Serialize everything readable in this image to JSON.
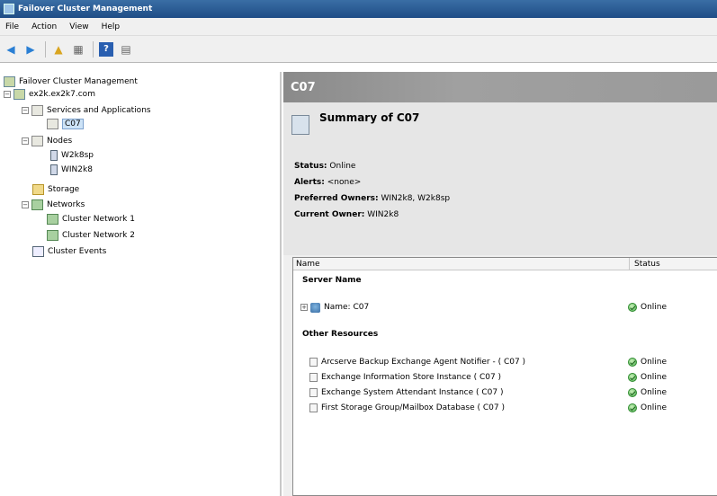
{
  "window": {
    "title": "Failover Cluster Management"
  },
  "menu": [
    "File",
    "Action",
    "View",
    "Help"
  ],
  "toolbar": {
    "buttons": [
      "back-icon",
      "forward-icon",
      "up-folder-icon",
      "show-hide-tree-icon",
      "help-icon",
      "properties-icon"
    ]
  },
  "tree": {
    "root": "Failover Cluster Management",
    "cluster": "ex2k.ex2k7.com",
    "services": "Services and Applications",
    "service_item": "C07",
    "nodes": "Nodes",
    "node_items": [
      "W2k8sp",
      "WIN2k8"
    ],
    "storage": "Storage",
    "networks": "Networks",
    "network_items": [
      "Cluster Network 1",
      "Cluster Network 2"
    ],
    "events": "Cluster Events"
  },
  "main": {
    "header": "C07",
    "summary_title": "Summary of C07",
    "status_label": "Status:",
    "status_value": "Online",
    "alerts_label": "Alerts:",
    "alerts_value": "<none>",
    "preferred_label": "Preferred Owners:",
    "preferred_value": "WIN2k8, W2k8sp",
    "current_label": "Current Owner:",
    "current_value": "WIN2k8"
  },
  "grid": {
    "col_name": "Name",
    "col_status": "Status",
    "server_section": "Server Name",
    "server_row": {
      "name": "Name: C07",
      "status": "Online"
    },
    "other_section": "Other Resources",
    "resources": [
      {
        "name": "Arcserve Backup Exchange Agent Notifier - ( C07 )",
        "status": "Online"
      },
      {
        "name": "Exchange Information Store Instance ( C07 )",
        "status": "Online"
      },
      {
        "name": "Exchange System Attendant Instance ( C07 )",
        "status": "Online"
      },
      {
        "name": "First Storage Group/Mailbox Database ( C07 )",
        "status": "Online"
      }
    ]
  },
  "colors": {
    "online": "#4caf50",
    "title_bar": "#1f4d86",
    "header_bg": "#8a8a8a"
  }
}
